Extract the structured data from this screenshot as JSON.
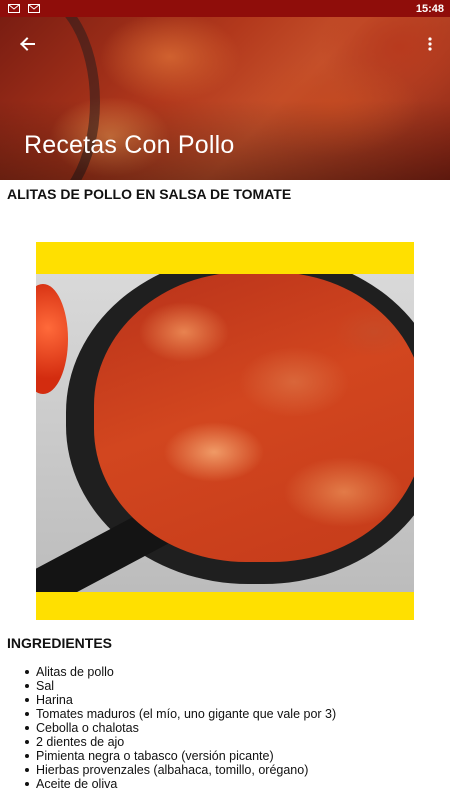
{
  "status_bar": {
    "time": "15:48",
    "notification_icons": [
      "gmail-icon",
      "gmail-icon"
    ],
    "background_color": "#8f0d0a"
  },
  "app_bar": {
    "title": "Recetas Con Pollo",
    "back_icon": "arrow-back-icon",
    "menu_icon": "more-vert-icon"
  },
  "recipe": {
    "title": "ALITAS DE POLLO EN SALSA DE TOMATE",
    "image_frame_color": "#ffe000",
    "ingredients_heading": "INGREDIENTES",
    "ingredients": [
      "Alitas de pollo",
      "Sal",
      "Harina",
      "Tomates maduros (el mío, uno gigante que vale por 3)",
      "Cebolla o chalotas",
      "2 dientes de ajo",
      "Pimienta negra o tabasco (versión picante)",
      "Hierbas provenzales (albahaca, tomillo, orégano)",
      "Aceite de oliva"
    ]
  }
}
